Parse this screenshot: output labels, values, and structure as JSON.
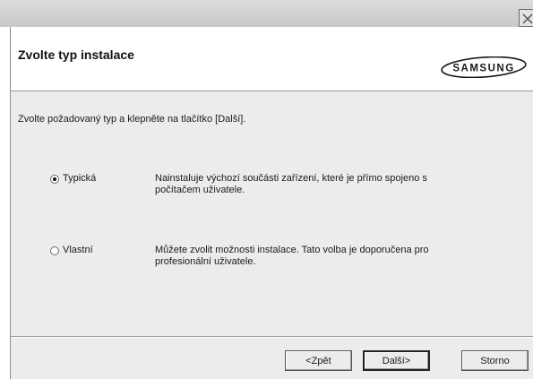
{
  "window": {
    "close_icon": "close-icon"
  },
  "header": {
    "title": "Zvolte typ instalace",
    "logo_text": "SAMSUNG"
  },
  "instruction": "Zvolte požadovaný typ a klepněte na tlačítko [Další].",
  "options": [
    {
      "label": "Typická",
      "selected": true,
      "description": "Nainstaluje výchozí součásti zařízení, které je přímo spojeno s počítačem uživatele."
    },
    {
      "label": "Vlastní",
      "selected": false,
      "description": "Můžete zvolit možnosti instalace. Tato volba je doporučena pro profesionální uživatele."
    }
  ],
  "buttons": {
    "back": "<Zpět",
    "next": "Další>",
    "cancel": "Storno"
  }
}
